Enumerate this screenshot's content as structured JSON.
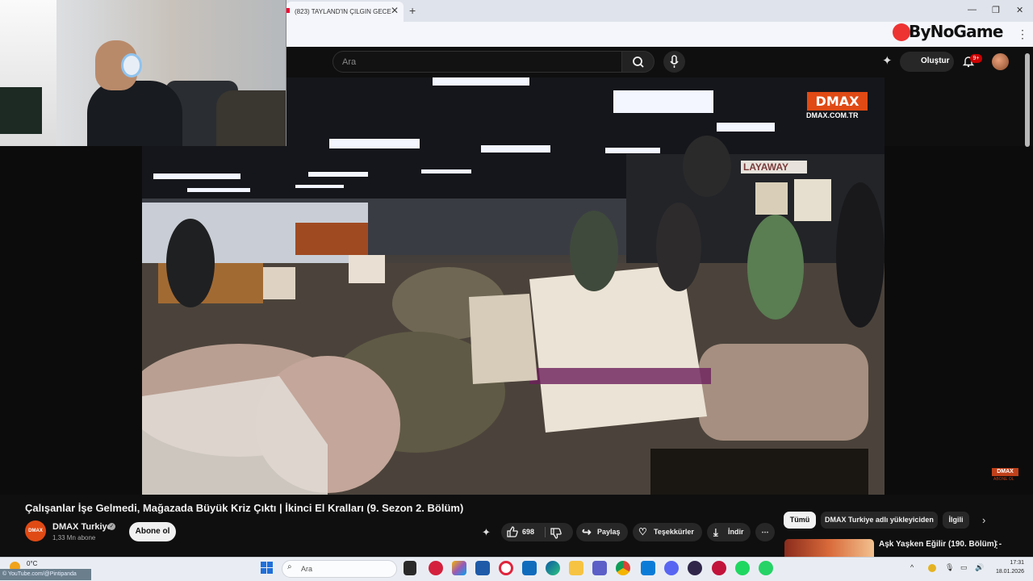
{
  "browser": {
    "tab_title": "(823) TAYLAND'IN ÇILGIN GECE",
    "tab_close": "✕",
    "new_tab": "+",
    "minimize": "—",
    "restore": "❐",
    "close": "✕",
    "menu": "⋮",
    "overlay_logo": "ByNoGame"
  },
  "youtube": {
    "search_placeholder": "Ara",
    "create_label": "Oluştur",
    "notification_badge": "9+"
  },
  "video_overlay": {
    "dmax_logo": "DMAX",
    "dmax_url": "DMAX.COM.TR",
    "dmax_corner": "DMAX",
    "dmax_corner_sub": "ABONE OL"
  },
  "video": {
    "title": "Çalışanlar İşe Gelmedi, Mağazada Büyük Kriz Çıktı | İkinci El Kralları (9. Sezon 2. Bölüm)",
    "channel_name": "DMAX Turkiye",
    "channel_avatar_text": "DMAX",
    "subscribers": "1,33 Mn abone",
    "subscribe_label": "Abone ol",
    "like_count": "698",
    "share_label": "Paylaş",
    "thanks_label": "Teşekkürler",
    "download_label": "İndir",
    "more_label": "⋯"
  },
  "sidebar": {
    "chips": [
      "Tümü",
      "DMAX Turkiye adlı yükleyiciden",
      "İlgili"
    ],
    "recommended": [
      {
        "title": "Aşk Yaşken Eğilir (190. Bölüm) -"
      }
    ]
  },
  "taskbar": {
    "temperature": "0°C",
    "streamer_tag": "© YouTube.com/@Pintipanda",
    "search_placeholder": "Ara",
    "time": "17:31",
    "date": "18.01.2026",
    "chevron": "^"
  },
  "colors": {
    "youtube_bg": "#0f0f0f",
    "dmax_orange": "#e04a14",
    "notification_red": "#cc0000",
    "taskbar_bg": "#e9edf3"
  }
}
